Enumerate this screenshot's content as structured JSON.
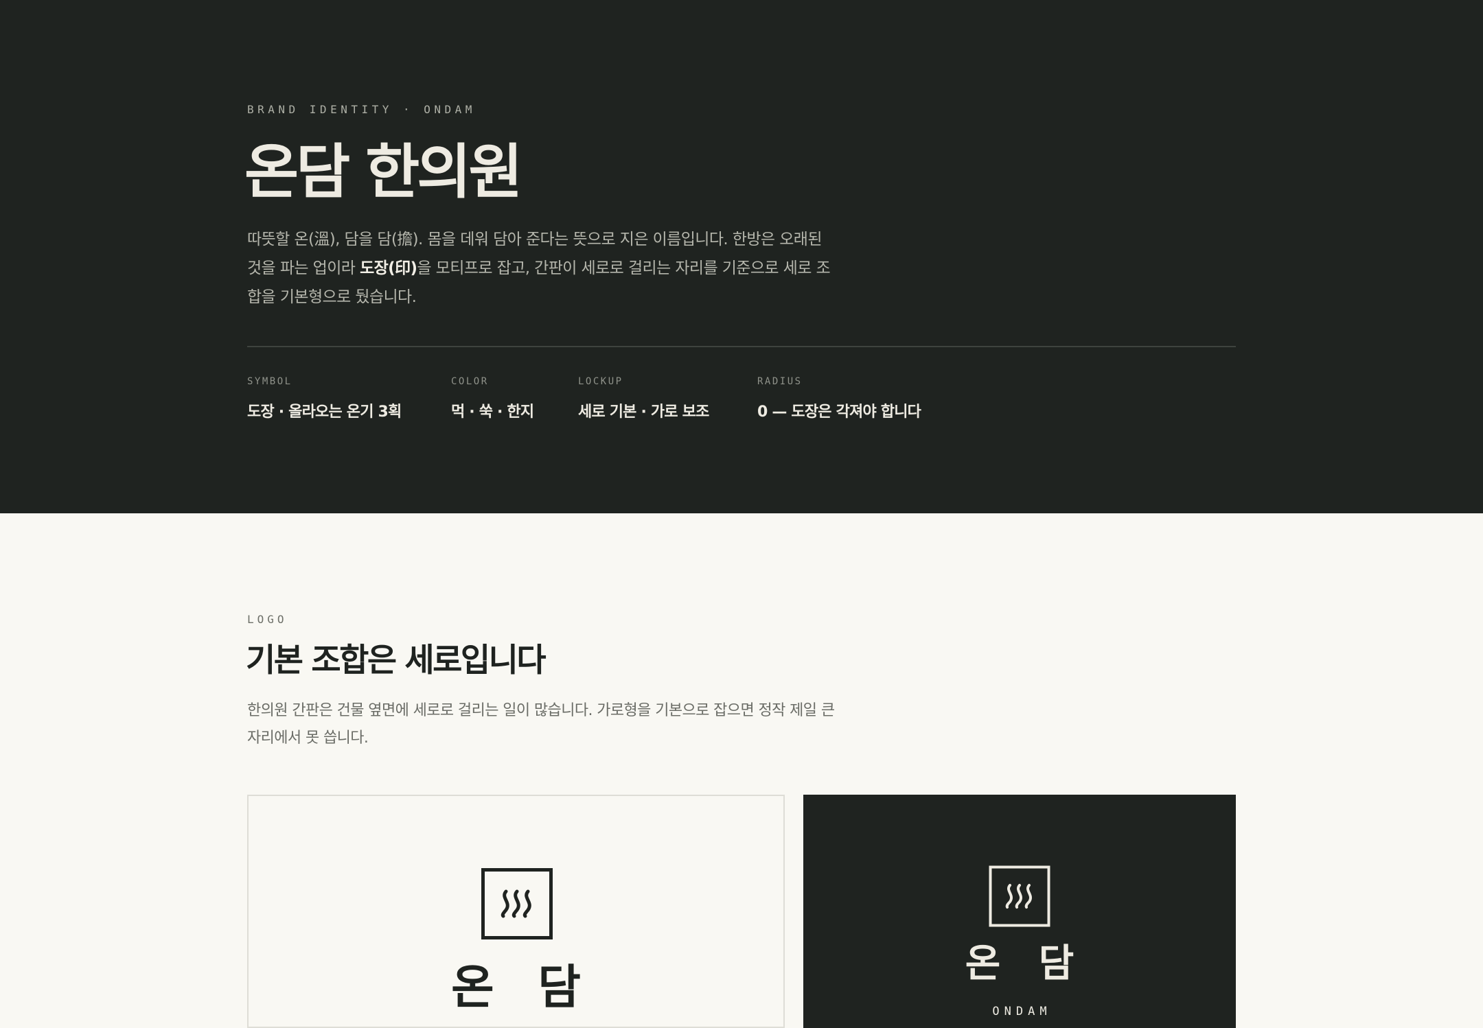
{
  "hero": {
    "eyebrow": "BRAND IDENTITY · ONDAM",
    "title": "온담 한의원",
    "description_before": "따뜻할 온(溫), 담을 담(擔). 몸을 데워 담아 준다는 뜻으로 지은 이름입니다. 한방은 오래된 것을 파는 업이라 ",
    "description_bold": "도장(印)",
    "description_after": "을 모티프로 잡고, 간판이 세로로 걸리는 자리를 기준으로 세로 조합을 기본형으로 뒀습니다.",
    "specs": [
      {
        "label": "SYMBOL",
        "value": "도장 · 올라오는 온기 3획"
      },
      {
        "label": "COLOR",
        "value": "먹 · 쑥 · 한지"
      },
      {
        "label": "LOCKUP",
        "value": "세로 기본 · 가로 보조"
      },
      {
        "label": "RADIUS",
        "value": "0 — 도장은 각져야 합니다"
      }
    ]
  },
  "logo": {
    "eyebrow": "LOGO",
    "title": "기본 조합은 세로입니다",
    "description": "한의원 간판은 건물 옆면에 세로로 걸리는 일이 많습니다. 가로형을 기본으로 잡으면 정작 제일 큰 자리에서 못 씁니다.",
    "light_card": {
      "wordmark": "온 담",
      "seal_icon": "seal-steam-icon"
    },
    "dark_card": {
      "wordmark": "온 담",
      "wordmark_en": "ONDAM",
      "seal_icon": "seal-steam-icon"
    }
  },
  "colors": {
    "ink": "#1f2320",
    "paper": "#f9f8f3",
    "muted": "#b5b6ac"
  }
}
